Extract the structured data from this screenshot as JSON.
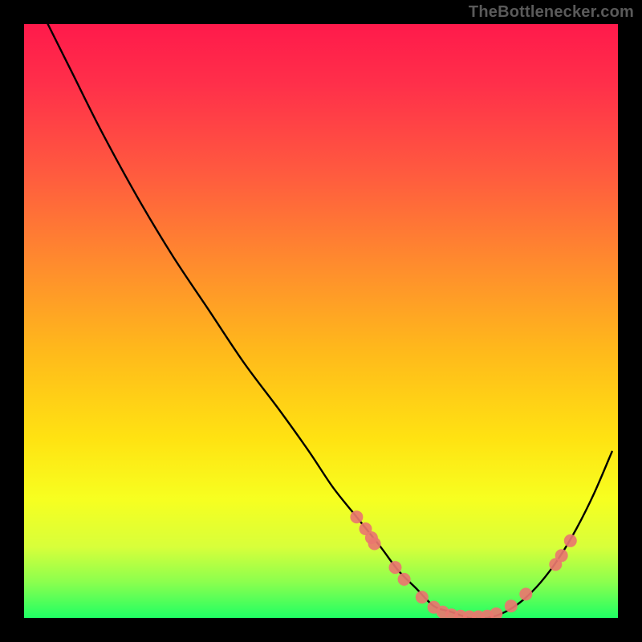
{
  "watermark": "TheBottlenecker.com",
  "chart_data": {
    "type": "line",
    "title": "",
    "xlabel": "",
    "ylabel": "",
    "xlim": [
      0,
      100
    ],
    "ylim": [
      0,
      100
    ],
    "note": "Axes carry no visible tick labels. x is normalized 0–100 left→right, y is normalized 0–100 bottom→top (0 at the green bottom edge).",
    "series": [
      {
        "name": "bottleneck-curve",
        "x": [
          4,
          8,
          13,
          19,
          25,
          31,
          37,
          43,
          48,
          52,
          56,
          60,
          63,
          66,
          69,
          72,
          75,
          78,
          81,
          84,
          87,
          90,
          93,
          96,
          99
        ],
        "y": [
          100,
          92,
          82,
          71,
          61,
          52,
          43,
          35,
          28,
          22,
          17,
          12,
          8,
          5,
          2,
          1,
          0,
          0,
          1,
          3,
          6,
          10,
          15,
          21,
          28
        ]
      }
    ],
    "markers": {
      "name": "highlighted-points",
      "color": "#e9776f",
      "points": [
        {
          "x": 56.0,
          "y": 17.0
        },
        {
          "x": 57.5,
          "y": 15.0
        },
        {
          "x": 58.5,
          "y": 13.5
        },
        {
          "x": 59.0,
          "y": 12.5
        },
        {
          "x": 62.5,
          "y": 8.5
        },
        {
          "x": 64.0,
          "y": 6.5
        },
        {
          "x": 67.0,
          "y": 3.5
        },
        {
          "x": 69.0,
          "y": 1.8
        },
        {
          "x": 70.5,
          "y": 1.0
        },
        {
          "x": 72.0,
          "y": 0.5
        },
        {
          "x": 73.5,
          "y": 0.3
        },
        {
          "x": 75.0,
          "y": 0.2
        },
        {
          "x": 76.5,
          "y": 0.2
        },
        {
          "x": 78.0,
          "y": 0.3
        },
        {
          "x": 79.5,
          "y": 0.7
        },
        {
          "x": 82.0,
          "y": 2.0
        },
        {
          "x": 84.5,
          "y": 4.0
        },
        {
          "x": 89.5,
          "y": 9.0
        },
        {
          "x": 90.5,
          "y": 10.5
        },
        {
          "x": 92.0,
          "y": 13.0
        }
      ]
    },
    "gradient_stops": [
      {
        "pos": 0.0,
        "color": "#ff1a4b"
      },
      {
        "pos": 0.1,
        "color": "#ff2f4a"
      },
      {
        "pos": 0.25,
        "color": "#ff5a3f"
      },
      {
        "pos": 0.4,
        "color": "#ff8a2e"
      },
      {
        "pos": 0.55,
        "color": "#ffb91b"
      },
      {
        "pos": 0.7,
        "color": "#ffe312"
      },
      {
        "pos": 0.8,
        "color": "#f7ff20"
      },
      {
        "pos": 0.88,
        "color": "#d8ff3a"
      },
      {
        "pos": 0.94,
        "color": "#8bff4e"
      },
      {
        "pos": 1.0,
        "color": "#1fff64"
      }
    ]
  }
}
